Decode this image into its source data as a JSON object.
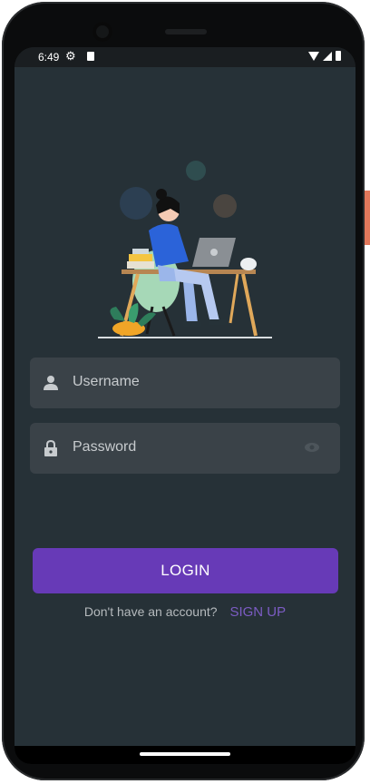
{
  "status_bar": {
    "time": "6:49",
    "icons": [
      "gear-icon",
      "sd-card-icon",
      "wifi-icon",
      "signal-icon",
      "battery-icon"
    ]
  },
  "illustration": {
    "description_icon": "person-at-laptop-illustration"
  },
  "login_form": {
    "username_placeholder": "Username",
    "password_placeholder": "Password",
    "login_label": "LOGIN",
    "signup_prompt": "Don't have an account?",
    "signup_label": "SIGN UP"
  },
  "colors": {
    "background": "#263137",
    "field_background": "#3a4248",
    "accent": "#673ab7",
    "accent_link": "#7c5cc4"
  }
}
